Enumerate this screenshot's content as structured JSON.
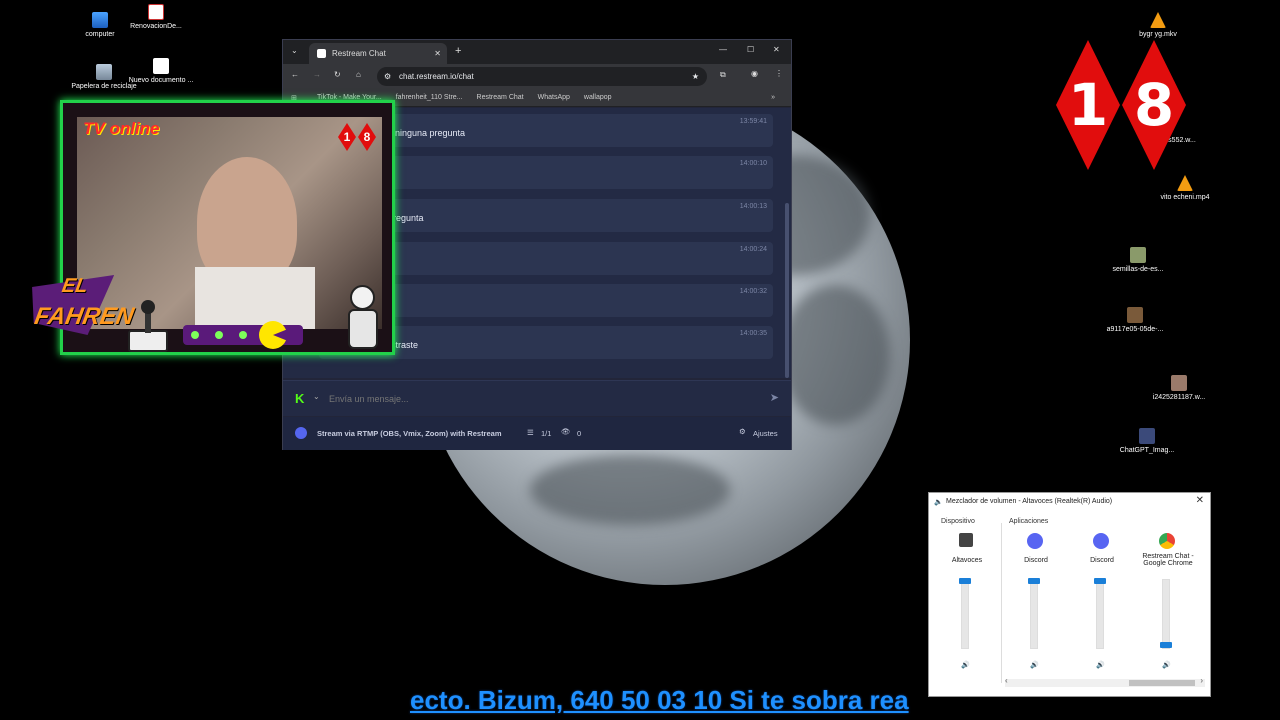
{
  "desktop": {
    "icons_left": [
      {
        "label": "computer"
      },
      {
        "label": "RenovacionDe..."
      },
      {
        "label": "Papelera de reciclaje"
      },
      {
        "label": "Nuevo documento ..."
      }
    ],
    "icons_right": [
      {
        "label": "bygr yg.mkv"
      },
      {
        "label": "s552.w..."
      },
      {
        "label": "vito echeni.mp4"
      },
      {
        "label": "semillas-de-es..."
      },
      {
        "label": "a9117e05-05de-..."
      },
      {
        "label": "i2425281187.w..."
      },
      {
        "label": "ChatGPT_Imag..."
      }
    ],
    "badge": {
      "digit1": "1",
      "digit2": "8",
      "color": "#e10d0d"
    }
  },
  "browser": {
    "tab_title": "Restream Chat",
    "url": "chat.restream.io/chat",
    "bookmarks": [
      "TikTok - Make Your...",
      "fahrenheit_110 Stre...",
      "Restream Chat",
      "WhatsApp",
      "wallapop"
    ],
    "messages": [
      {
        "time": "13:59:41",
        "text": "ninguna pregunta"
      },
      {
        "time": "14:00:10",
        "text": ""
      },
      {
        "time": "14:00:13",
        "text": "regunta"
      },
      {
        "time": "14:00:24",
        "text": ""
      },
      {
        "time": "14:00:32",
        "text": ""
      },
      {
        "time": "14:00:35",
        "text": "nnunca lo demostraste"
      }
    ],
    "compose_placeholder": "Envía un mensaje...",
    "footer": {
      "stream_text": "Stream via RTMP (OBS, Vmix, Zoom) with Restream",
      "count": "1/1",
      "viewers": "0",
      "settings": "Ajustes"
    }
  },
  "overlay": {
    "title": "TV online",
    "brand_line1": "EL",
    "brand_line2": "FAHREN",
    "badge1": "1",
    "badge2": "8",
    "frame_color": "#22d14a"
  },
  "mixer": {
    "title": "Mezclador de volumen - Altavoces (Realtek(R) Audio)",
    "section_device": "Dispositivo",
    "section_apps": "Aplicaciones",
    "channels": [
      {
        "name": "Altavoces",
        "level": 1.0
      },
      {
        "name": "Discord",
        "level": 1.0
      },
      {
        "name": "Discord",
        "level": 1.0
      },
      {
        "name": "Restream Chat - Google Chrome",
        "level": 0.0
      }
    ]
  },
  "ticker": {
    "text": "ecto. Bizum, 640 50 03 10 Si te sobra rea"
  }
}
